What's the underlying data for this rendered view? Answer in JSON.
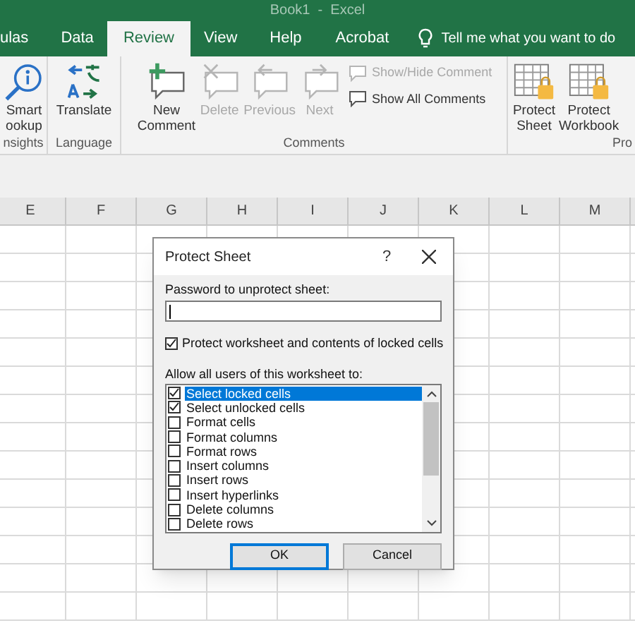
{
  "window": {
    "title": "Book1  -  Excel"
  },
  "ribbon_tabs": [
    {
      "label": "ulas",
      "selected": false
    },
    {
      "label": "Data",
      "selected": false
    },
    {
      "label": "Review",
      "selected": true
    },
    {
      "label": "View",
      "selected": false
    },
    {
      "label": "Help",
      "selected": false
    },
    {
      "label": "Acrobat",
      "selected": false
    }
  ],
  "tell_me": {
    "text": "Tell me what you want to do"
  },
  "ribbon_groups": [
    {
      "label": "nsights",
      "commands": [
        {
          "kind": "large",
          "lines": [
            "Smart",
            "ookup"
          ],
          "disabled": false
        }
      ]
    },
    {
      "label": "Language",
      "commands": [
        {
          "kind": "large",
          "lines": [
            "Translate"
          ],
          "disabled": false
        }
      ]
    },
    {
      "label": "Comments",
      "commands": [
        {
          "kind": "large",
          "lines": [
            "New",
            "Comment"
          ],
          "disabled": false
        },
        {
          "kind": "large",
          "lines": [
            "Delete"
          ],
          "disabled": true
        },
        {
          "kind": "large",
          "lines": [
            "Previous"
          ],
          "disabled": true
        },
        {
          "kind": "large",
          "lines": [
            "Next"
          ],
          "disabled": true
        },
        {
          "kind": "small",
          "lines": [
            "Show/Hide Comment"
          ],
          "disabled": true
        },
        {
          "kind": "small",
          "lines": [
            "Show All Comments"
          ],
          "disabled": false
        }
      ]
    },
    {
      "label": "Pro",
      "commands": [
        {
          "kind": "large",
          "lines": [
            "Protect",
            "Sheet"
          ],
          "disabled": false
        },
        {
          "kind": "large",
          "lines": [
            "Protect",
            "Workbook"
          ],
          "disabled": false
        }
      ]
    }
  ],
  "column_headers": [
    "E",
    "F",
    "G",
    "H",
    "I",
    "J",
    "K",
    "L",
    "M"
  ],
  "dialog": {
    "title": "Protect Sheet",
    "help": "?",
    "password_label": "Password to unprotect sheet:",
    "protect_checkbox": {
      "label": "Protect worksheet and contents of locked cells",
      "checked": true
    },
    "allow_label": "Allow all users of this worksheet to:",
    "permissions": [
      {
        "label": "Select locked cells",
        "checked": true,
        "selected": true
      },
      {
        "label": "Select unlocked cells",
        "checked": true,
        "selected": false
      },
      {
        "label": "Format cells",
        "checked": false,
        "selected": false
      },
      {
        "label": "Format columns",
        "checked": false,
        "selected": false
      },
      {
        "label": "Format rows",
        "checked": false,
        "selected": false
      },
      {
        "label": "Insert columns",
        "checked": false,
        "selected": false
      },
      {
        "label": "Insert rows",
        "checked": false,
        "selected": false
      },
      {
        "label": "Insert hyperlinks",
        "checked": false,
        "selected": false
      },
      {
        "label": "Delete columns",
        "checked": false,
        "selected": false
      },
      {
        "label": "Delete rows",
        "checked": false,
        "selected": false
      }
    ],
    "buttons": [
      {
        "label": "OK",
        "default": true
      },
      {
        "label": "Cancel",
        "default": false
      }
    ]
  }
}
